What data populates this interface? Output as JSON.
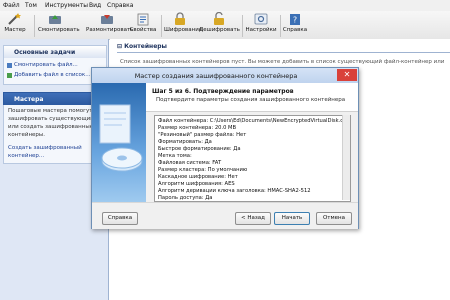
{
  "menu": [
    "Файл",
    "Том",
    "Инструменты",
    "Вид",
    "Справка"
  ],
  "toolbar": {
    "master": "Мастер",
    "mount": "Смонтировать",
    "unmount": "Размонтировать",
    "properties": "Свойства",
    "encrypt": "Шифрование",
    "decrypt": "Дешифровать",
    "settings": "Настройки",
    "help": "Справка"
  },
  "left": {
    "tasks_title": "Основные задачи",
    "task_mount": "Смонтировать файл...",
    "task_add": "Добавить файл в список...",
    "wizard_title": "Мастера",
    "wizard_desc": [
      "Пошаговые мастера помогут",
      "зашифровать существующий",
      "или создать зашифрованные",
      "контейнеры."
    ],
    "wizard_link": [
      "Создать зашифрованный",
      "контейнер..."
    ]
  },
  "main": {
    "title": "Контейнеры",
    "desc": "Список зашифрованных контейнеров пуст. Вы можете добавить в список существующий файл-контейнер или"
  },
  "dialog": {
    "title": "Мастер создания зашифрованного контейнера",
    "close": "✕",
    "step": "Шаг 5 из 6. Подтверждение параметров",
    "subtitle": "Подтвердите параметры создания зашифрованного контейнера",
    "summary": [
      "Файл контейнера: C:\\Users\\Ed\\Documents\\NewEncryptedVirtualDisk.crv",
      "Размер контейнера: 20.0 MB",
      "\"Резиновый\" размер файла: Нет",
      "Форматировать: Да",
      "   Быстрое форматирование: Да",
      "   Метка тома:",
      "   Файловая система: FAT",
      "   Размер кластера: По умолчанию",
      "Каскадное шифрование: Нет",
      "Алгоритм шифрования: AES",
      "Алгоритм деривации ключа заголовка: HMAC-SHA2-512",
      "Пароль доступа: Да"
    ],
    "btn_help": "Справка",
    "btn_back": "< Назад",
    "btn_start": "Начать",
    "btn_cancel": "Отмена"
  }
}
